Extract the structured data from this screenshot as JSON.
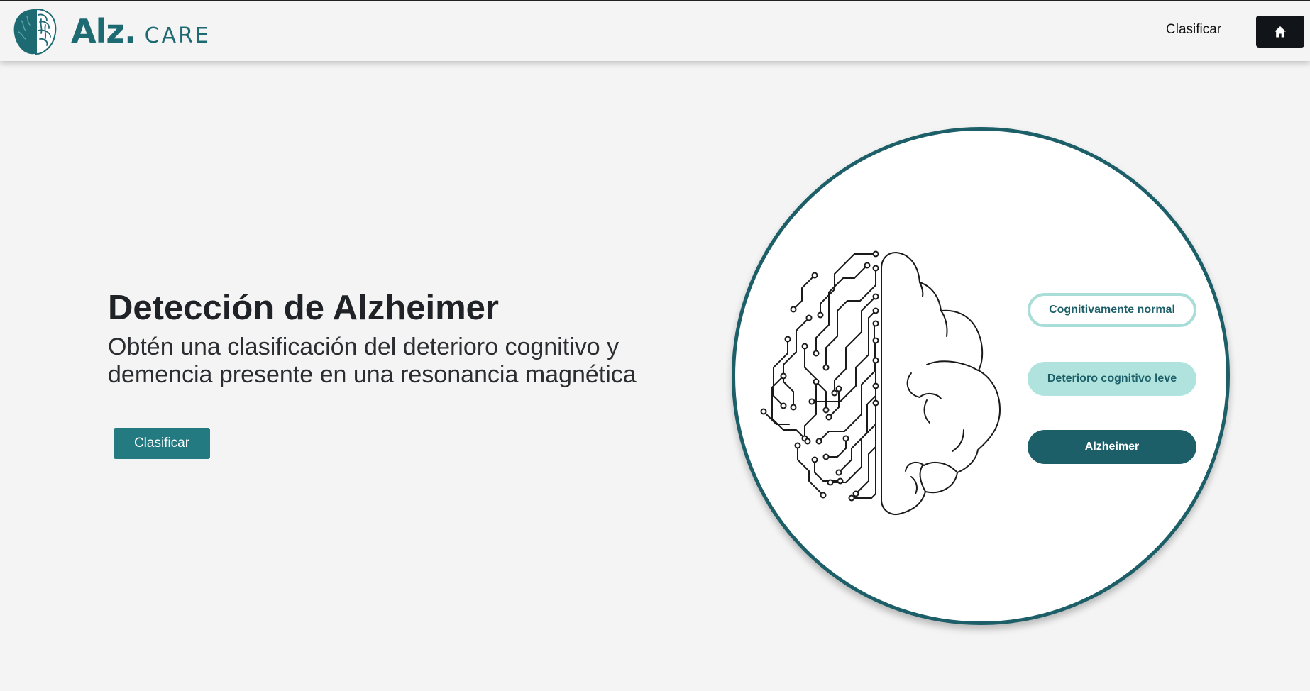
{
  "header": {
    "brand": {
      "logo_icon": "brain-icon",
      "name": "Alz.",
      "suffix": "CARE"
    },
    "nav_link": "Clasificar",
    "home_icon": "home-icon"
  },
  "hero": {
    "title": "Detección de Alzheimer",
    "subtitle": "Obtén una clasificación del deterioro cognitivo y demencia presente en una resonancia magnética",
    "button_label": "Clasificar"
  },
  "illustration": {
    "icon": "brain-circuit-icon",
    "categories": [
      "Cognitivamente normal",
      "Deterioro cognitivo leve",
      "Alzheimer"
    ]
  },
  "colors": {
    "brand": "#1e6a72",
    "button": "#237a81",
    "circle_border": "#1d5f68",
    "pill_light": "#b0e3de",
    "pill_dark": "#1d5f68",
    "home_button": "#111418"
  }
}
